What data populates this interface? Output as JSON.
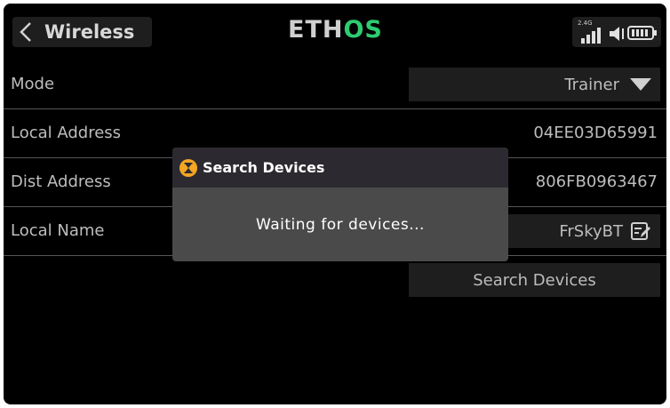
{
  "header": {
    "title": "Wireless",
    "logo_main": "ETH",
    "logo_accent": "OS",
    "band_label": "2.4G"
  },
  "rows": {
    "mode": {
      "label": "Mode",
      "value": "Trainer"
    },
    "local_address": {
      "label": "Local Address",
      "value": "04EE03D65991"
    },
    "dist_address": {
      "label": "Dist Address",
      "value": "806FB0963467"
    },
    "local_name": {
      "label": "Local Name",
      "value": "FrSkyBT"
    }
  },
  "search_button": {
    "label": "Search Devices"
  },
  "dialog": {
    "title": "Search Devices",
    "message": "Waiting for devices..."
  },
  "colors": {
    "background": "#000000",
    "panel": "#1e1e1e",
    "text": "#bdbdbd",
    "accent": "#2ecc71",
    "dialog_body": "#4a4a4a",
    "dialog_head": "#2c2a30",
    "hourglass": "#f5a623"
  },
  "icons": [
    "back-chevron-icon",
    "signal-icon",
    "volume-icon",
    "battery-icon",
    "dropdown-arrow-icon",
    "edit-icon",
    "hourglass-icon"
  ]
}
